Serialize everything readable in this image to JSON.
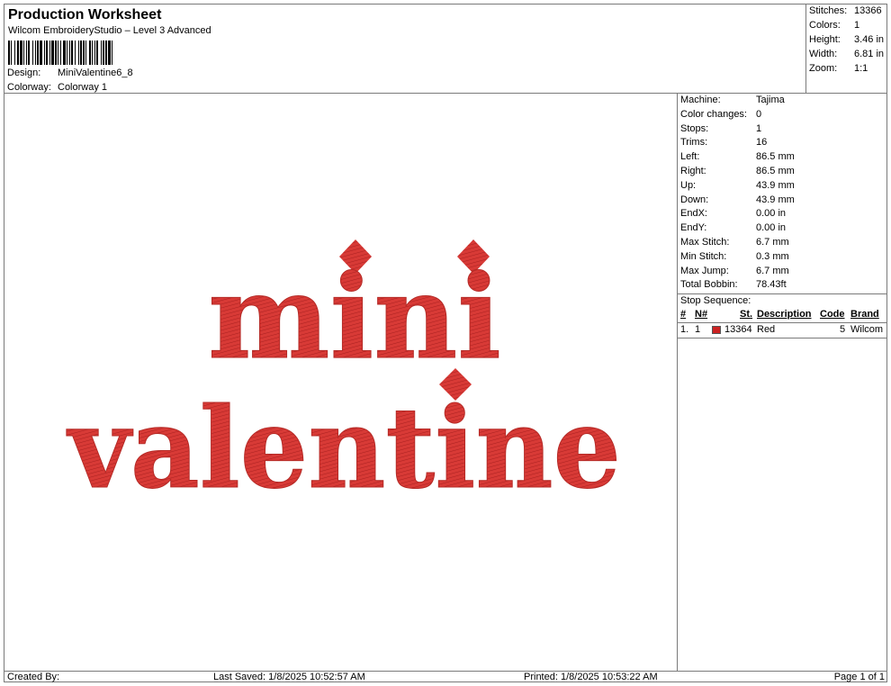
{
  "header": {
    "title": "Production Worksheet",
    "subtitle": "Wilcom EmbroideryStudio – Level 3 Advanced",
    "design_label": "Design:",
    "design_value": "MiniValentine6_8",
    "colorway_label": "Colorway:",
    "colorway_value": "Colorway 1"
  },
  "stats": [
    {
      "label": "Stitches:",
      "value": "13366"
    },
    {
      "label": "Colors:",
      "value": "1"
    },
    {
      "label": "Height:",
      "value": "3.46 in"
    },
    {
      "label": "Width:",
      "value": "6.81 in"
    },
    {
      "label": "Zoom:",
      "value": "1:1"
    }
  ],
  "machine_info": [
    {
      "label": "Machine:",
      "value": "Tajima"
    },
    {
      "label": "Color changes:",
      "value": "0"
    },
    {
      "label": "Stops:",
      "value": "1"
    },
    {
      "label": "Trims:",
      "value": "16"
    },
    {
      "label": "Left:",
      "value": "86.5 mm"
    },
    {
      "label": "Right:",
      "value": "86.5 mm"
    },
    {
      "label": "Up:",
      "value": "43.9 mm"
    },
    {
      "label": "Down:",
      "value": "43.9 mm"
    },
    {
      "label": "EndX:",
      "value": "0.00 in"
    },
    {
      "label": "EndY:",
      "value": "0.00 in"
    },
    {
      "label": "Max Stitch:",
      "value": "6.7 mm"
    },
    {
      "label": "Min Stitch:",
      "value": "0.3 mm"
    },
    {
      "label": "Max Jump:",
      "value": "6.7 mm"
    },
    {
      "label": "Total Bobbin:",
      "value": "78.43ft"
    }
  ],
  "stop_sequence": {
    "title": "Stop Sequence:",
    "headers": {
      "num": "#",
      "n": "N#",
      "st": "St.",
      "description": "Description",
      "code": "Code",
      "brand": "Brand"
    },
    "rows": [
      {
        "num": "1.",
        "n": "1",
        "st": "13364",
        "description": "Red",
        "code": "5",
        "brand": "Wilcom",
        "color": "#cc2222"
      }
    ]
  },
  "design": {
    "line1": "mini",
    "line2": "valentine",
    "thread_color": "#d83a36"
  },
  "footer": {
    "created_by": "Created By:",
    "last_saved": "Last Saved: 1/8/2025 10:52:57 AM",
    "printed": "Printed: 1/8/2025 10:53:22 AM",
    "page": "Page 1 of 1"
  }
}
